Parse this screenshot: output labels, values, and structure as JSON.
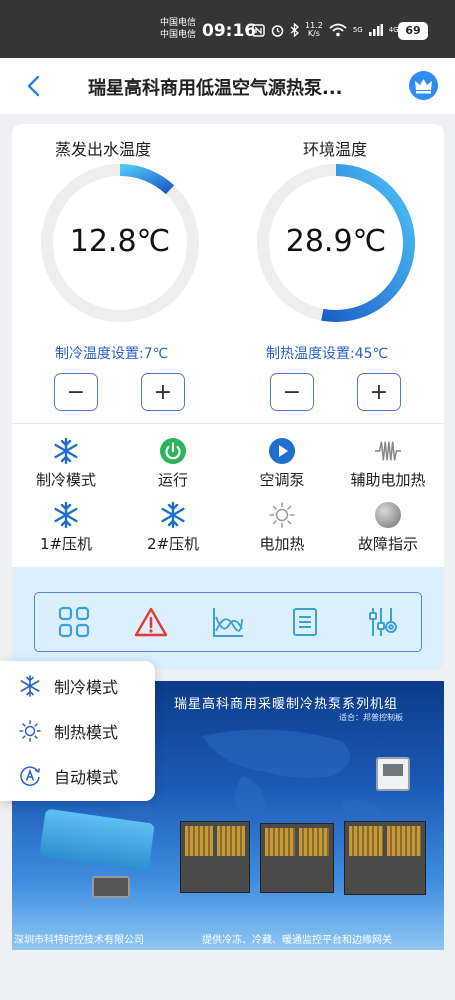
{
  "status_bar": {
    "carrier_1": "中国电信",
    "carrier_2": "中国电信",
    "time": "09:16",
    "net_speed_value": "11.2",
    "net_speed_unit": "K/s",
    "wifi_badge": "5G",
    "signal_badge": "4G",
    "battery": "69"
  },
  "header": {
    "title": "瑞星高科商用低温空气源热泵..."
  },
  "gauges": [
    {
      "title": "蒸发出水温度",
      "value": "12.8℃",
      "setting_label": "制冷温度设置:7℃",
      "fill": 0.12
    },
    {
      "title": "环境温度",
      "value": "28.9℃",
      "setting_label": "制热温度设置:45℃",
      "fill": 0.53
    }
  ],
  "buttons": {
    "minus": "−",
    "plus": "+"
  },
  "status_items": [
    {
      "label": "制冷模式",
      "icon": "snowflake-icon"
    },
    {
      "label": "运行",
      "icon": "power-icon"
    },
    {
      "label": "空调泵",
      "icon": "play-icon"
    },
    {
      "label": "辅助电加热",
      "icon": "heating-coil-icon"
    },
    {
      "label": "1#压机",
      "icon": "snowflake-icon"
    },
    {
      "label": "2#压机",
      "icon": "snowflake-icon"
    },
    {
      "label": "电加热",
      "icon": "sun-icon"
    },
    {
      "label": "故障指示",
      "icon": "indicator-light-icon"
    }
  ],
  "toolbar": [
    "grid-icon",
    "alarm-icon",
    "chart-icon",
    "list-icon",
    "settings-sliders-icon"
  ],
  "mode_menu": [
    {
      "label": "制冷模式",
      "icon": "snowflake-icon"
    },
    {
      "label": "制热模式",
      "icon": "sun-icon"
    },
    {
      "label": "自动模式",
      "icon": "auto-mode-icon"
    }
  ],
  "banner": {
    "title": "瑞星高科商用采暖制冷热泵系列机组",
    "subtitle": "适合：邦普控制板",
    "footer_left": "深圳市科特时控技术有限公司",
    "footer_right": "提供冷冻、冷藏、暖通监控平台和边缘网关"
  },
  "colors": {
    "accent": "#2f8cf0",
    "gauge_track": "#eeeeee",
    "gauge_arc_start": "#1a5fc8",
    "gauge_arc_end": "#4fc3f7",
    "setting_text": "#2a63c8",
    "power_green": "#2bb45a",
    "alarm_red": "#e53935",
    "toolbar_bg": "#dcefff"
  }
}
